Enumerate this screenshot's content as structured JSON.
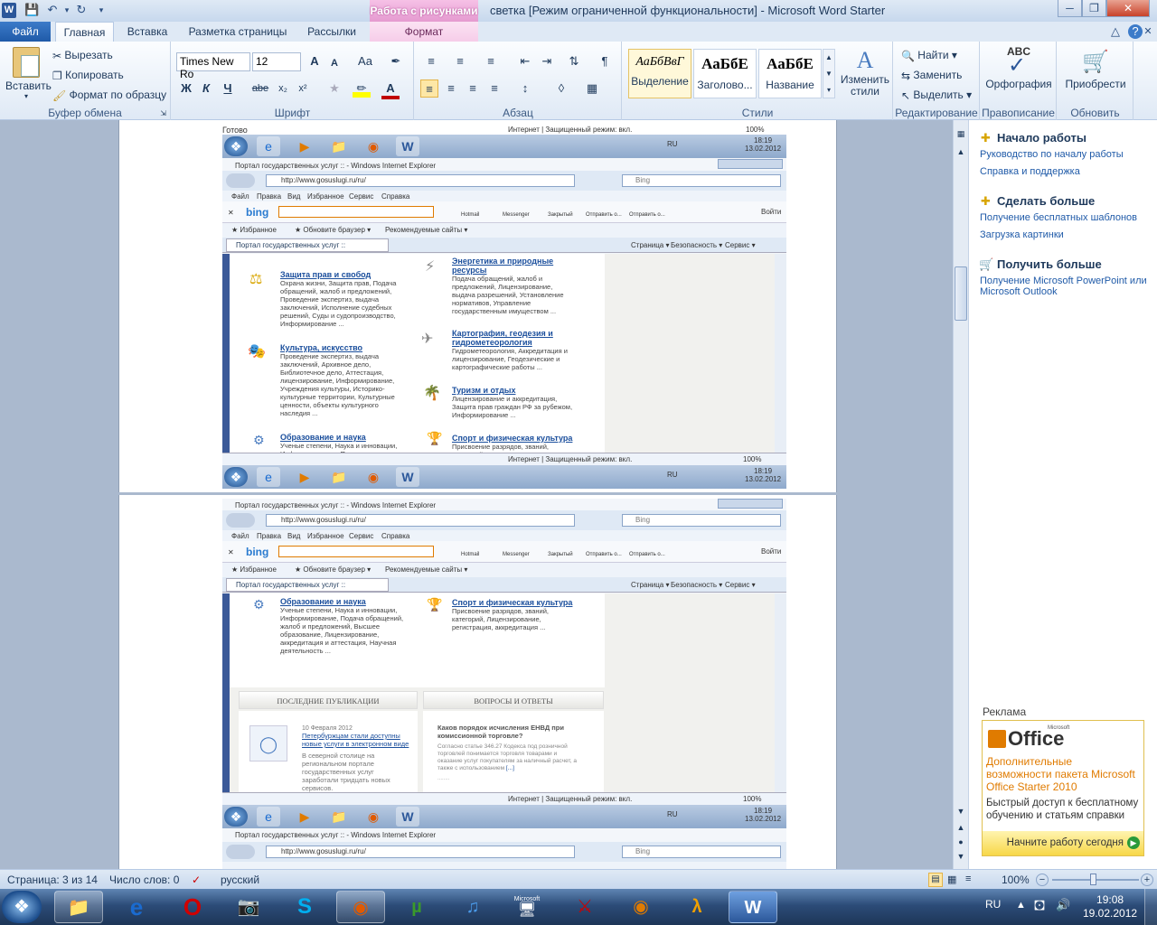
{
  "window": {
    "title": "светка [Режим ограниченной функциональности]  -  Microsoft Word Starter",
    "context_tab_header": "Работа с рисунками",
    "app_icon_letter": "W"
  },
  "tabs": {
    "file": "Файл",
    "home": "Главная",
    "insert": "Вставка",
    "layout": "Разметка страницы",
    "mailings": "Рассылки",
    "format": "Формат"
  },
  "clipboard": {
    "paste": "Вставить",
    "cut": "Вырезать",
    "copy": "Копировать",
    "format_painter": "Формат по образцу",
    "label": "Буфер обмена"
  },
  "font": {
    "name": "Times New Ro",
    "size": "12",
    "label": "Шрифт",
    "bold": "Ж",
    "italic": "К",
    "underline": "Ч",
    "strike": "abe",
    "sub": "x₂",
    "sup": "x²",
    "grow": "A",
    "shrink": "A",
    "case": "Aa",
    "color_letter": "A"
  },
  "paragraph": {
    "label": "Абзац"
  },
  "styles": {
    "label": "Стили",
    "items": [
      {
        "sample": "АаБбВвГ",
        "name": "Выделение"
      },
      {
        "sample": "АаБбЕ",
        "name": "Заголово..."
      },
      {
        "sample": "АаБбЕ",
        "name": "Название"
      }
    ],
    "change": "Изменить стили"
  },
  "editing": {
    "label": "Редактирование",
    "find": "Найти",
    "replace": "Заменить",
    "select": "Выделить"
  },
  "proofing": {
    "label": "Правописание",
    "spelling": "Орфография",
    "abc": "ABC"
  },
  "upgrade": {
    "label": "Обновить",
    "purchase": "Приобрести"
  },
  "screenshot_ie": {
    "status_ready": "Готово",
    "status_zone": "Интернет | Защищенный режим: вкл.",
    "zoom": "100%",
    "lang": "RU",
    "clock_time": "18:19",
    "clock_date": "13.02.2012",
    "ie_title": "Портал государственных услуг :: - Windows Internet Explorer",
    "url": "http://www.gosuslugi.ru/ru/",
    "search_placeholder": "Bing",
    "menu": [
      "Файл",
      "Правка",
      "Вид",
      "Избранное",
      "Сервис",
      "Справка"
    ],
    "bing": "bing",
    "bing_buttons": [
      "Hotmail",
      "Messenger",
      "Закрытый",
      "Отправить о...",
      "Отправить о..."
    ],
    "login": "Войти",
    "favorites": "Избранное",
    "update_browser": "Обновите браузер",
    "suggested": "Рекомендуемые сайты",
    "tab_title": "Портал государственных услуг ::",
    "cmd": [
      "Страница",
      "Безопасность",
      "Сервис"
    ],
    "fragment": "........",
    "categories": [
      {
        "title": "Защита прав и свобод",
        "desc": "Охрана жизни, Защита прав, Подача обращений, жалоб и предложений, Проведение экспертиз, выдача заключений, Исполнение судебных решений, Суды и судопроизводство, Информирование ..."
      },
      {
        "title": "Культура, искусство",
        "desc": "Проведение экспертиз, выдача заключений, Архивное дело, Библиотечное дело, Аттестация, лицензирование, Информирование, Учреждения культуры, Историко-культурные территории, Культурные ценности, объекты культурного наследия ..."
      },
      {
        "title": "Образование и наука",
        "desc": "Ученые степени, Наука и инновации, Информирование, Подача обращений, жалоб и предложений, Высшее образование, Лицензирование, аккредитация и аттестация, Научная деятельность ..."
      },
      {
        "title": "Энергетика и природные ресурсы",
        "desc": "Подача обращений, жалоб и предложений, Лицензирование, выдача разрешений, Установление нормативов, Управление государственным имуществом ..."
      },
      {
        "title": "Картография, геодезия и гидрометеорология",
        "desc": "Гидрометеорология, Аккредитация и лицензирование, Геодезические и картографические работы ..."
      },
      {
        "title": "Туризм и отдых",
        "desc": "Лицензирование и аккредитация, Защита прав граждан РФ за рубежом, Информирование ..."
      },
      {
        "title": "Спорт и физическая культура",
        "desc": "Присвоение разрядов, званий, категорий, Лицензирование, регистрация, аккредитация ..."
      }
    ],
    "pub_header": "ПОСЛЕДНИЕ ПУБЛИКАЦИИ",
    "qa_header": "ВОПРОСЫ И ОТВЕТЫ",
    "pub_date": "10 Февраля 2012",
    "pub_title": "Петербуржцам стали доступны новые услуги в электронном виде",
    "pub_text": "В северной столице на региональном портале государственных услуг заработали тридцать новых сервисов.",
    "qa_title": "Каков порядок исчисления ЕНВД при комиссионной торговле?",
    "qa_text": "Согласно статье 346.27 Кодекса под розничной торговлей понимается торговля товарами и оказание услуг покупателям за наличный расчет, а также с использованием",
    "qa_more": "[...]"
  },
  "sidepanel": {
    "sec1_title": "Начало работы",
    "sec1_links": [
      "Руководство по началу работы",
      "Справка и поддержка"
    ],
    "sec2_title": "Сделать больше",
    "sec2_links": [
      "Получение бесплатных шаблонов",
      "Загрузка картинки"
    ],
    "sec3_title": "Получить больше",
    "sec3_link_line1": "Получение Microsoft PowerPoint или",
    "sec3_link_line2": "Microsoft Outlook",
    "ad_label": "Реклама",
    "ad_brand": "Office",
    "ad_ms": "Microsoft",
    "ad_headline_1": "Дополнительные",
    "ad_headline_2": "возможности пакета Microsoft",
    "ad_headline_3": "Office Starter 2010",
    "ad_body_1": "Быстрый доступ к бесплатному",
    "ad_body_2": "обучению и статьям справки",
    "ad_button": "Начните работу сегодня"
  },
  "statusbar": {
    "page": "Страница: 3 из 14",
    "words": "Число слов: 0",
    "lang": "русский",
    "zoom": "100%"
  },
  "taskbar": {
    "lang": "RU",
    "time": "19:08",
    "date": "19.02.2012",
    "ms_label": "Microsoft"
  },
  "colors": {
    "accent": "#2b579a",
    "link": "#1f5aa8",
    "ctx_tab": "#e59ad0",
    "ad_orange": "#e07b00"
  }
}
